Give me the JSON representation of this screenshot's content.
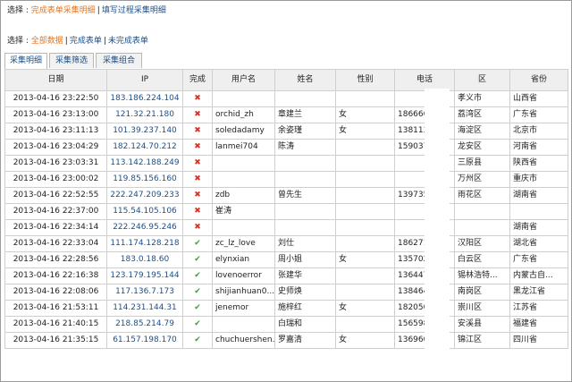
{
  "top": {
    "select_label": "选择 :",
    "complete_detail": "完成表单采集明细",
    "process_detail": "填写过程采集明细"
  },
  "filter": {
    "select_label": "选择 :",
    "all": "全部数据",
    "done": "完成表单",
    "undone": "未完成表单"
  },
  "tabs": [
    "采集明细",
    "采集筛选",
    "采集组合"
  ],
  "table": {
    "headers": [
      "日期",
      "IP",
      "完成",
      "用户名",
      "姓名",
      "性别",
      "电话",
      "区",
      "省份"
    ],
    "rows": [
      {
        "date": "2013-04-16 23:22:50",
        "ip": "183.186.224.104",
        "done": "✖",
        "user": "",
        "name": "",
        "sex": "",
        "phone": "",
        "district": "孝义市",
        "province": "山西省"
      },
      {
        "date": "2013-04-16 23:13:00",
        "ip": "121.32.21.180",
        "done": "✖",
        "user": "orchid_zh",
        "name": "章建兰",
        "sex": "女",
        "phone": "186666",
        "district": "荔湾区",
        "province": "广东省"
      },
      {
        "date": "2013-04-16 23:11:13",
        "ip": "101.39.237.140",
        "done": "✖",
        "user": "soledadamy",
        "name": "余姿瑾",
        "sex": "女",
        "phone": "138113",
        "district": "海淀区",
        "province": "北京市"
      },
      {
        "date": "2013-04-16 23:04:29",
        "ip": "182.124.70.212",
        "done": "✖",
        "user": "lanmei704",
        "name": "陈涛",
        "sex": "",
        "phone": "159037",
        "district": "龙安区",
        "province": "河南省"
      },
      {
        "date": "2013-04-16 23:03:31",
        "ip": "113.142.188.249",
        "done": "✖",
        "user": "",
        "name": "",
        "sex": "",
        "phone": "",
        "district": "三原县",
        "province": "陕西省"
      },
      {
        "date": "2013-04-16 23:00:02",
        "ip": "119.85.156.160",
        "done": "✖",
        "user": "",
        "name": "",
        "sex": "",
        "phone": "",
        "district": "万州区",
        "province": "重庆市"
      },
      {
        "date": "2013-04-16 22:52:55",
        "ip": "222.247.209.233",
        "done": "✖",
        "user": "zdb",
        "name": "曾先生",
        "sex": "",
        "phone": "139735",
        "district": "雨花区",
        "province": "湖南省"
      },
      {
        "date": "2013-04-16 22:37:00",
        "ip": "115.54.105.106",
        "done": "✖",
        "user": "崔涛",
        "name": "",
        "sex": "",
        "phone": "",
        "district": "",
        "province": ""
      },
      {
        "date": "2013-04-16 22:34:14",
        "ip": "222.246.95.246",
        "done": "✖",
        "user": "",
        "name": "",
        "sex": "",
        "phone": "",
        "district": "",
        "province": "湖南省"
      },
      {
        "date": "2013-04-16 22:33:04",
        "ip": "111.174.128.218",
        "done": "✔",
        "user": "zc_lz_love",
        "name": "刘仕",
        "sex": "",
        "phone": "186271",
        "district": "汉阳区",
        "province": "湖北省"
      },
      {
        "date": "2013-04-16 22:28:56",
        "ip": "183.0.18.60",
        "done": "✔",
        "user": "elynxian",
        "name": "周小姐",
        "sex": "女",
        "phone": "135702",
        "district": "白云区",
        "province": "广东省"
      },
      {
        "date": "2013-04-16 22:16:38",
        "ip": "123.179.195.144",
        "done": "✔",
        "user": "lovenoerror",
        "name": "张建华",
        "sex": "",
        "phone": "136447",
        "district": "锡林浩特...",
        "province": "内蒙古自..."
      },
      {
        "date": "2013-04-16 22:08:06",
        "ip": "117.136.7.173",
        "done": "✔",
        "user": "shijianhuan0...",
        "name": "史师焕",
        "sex": "",
        "phone": "138464",
        "district": "南岗区",
        "province": "黑龙江省"
      },
      {
        "date": "2013-04-16 21:53:11",
        "ip": "114.231.144.31",
        "done": "✔",
        "user": "jenemor",
        "name": "施梓红",
        "sex": "女",
        "phone": "182050",
        "district": "崇川区",
        "province": "江苏省"
      },
      {
        "date": "2013-04-16 21:40:15",
        "ip": "218.85.214.79",
        "done": "✔",
        "user": "",
        "name": "白瑞和",
        "sex": "",
        "phone": "156598",
        "district": "安溪县",
        "province": "福建省"
      },
      {
        "date": "2013-04-16 21:35:15",
        "ip": "61.157.198.170",
        "done": "✔",
        "user": "chuchuershen...",
        "name": "罗嘉清",
        "sex": "女",
        "phone": "136960",
        "district": "锦江区",
        "province": "四川省"
      }
    ]
  }
}
